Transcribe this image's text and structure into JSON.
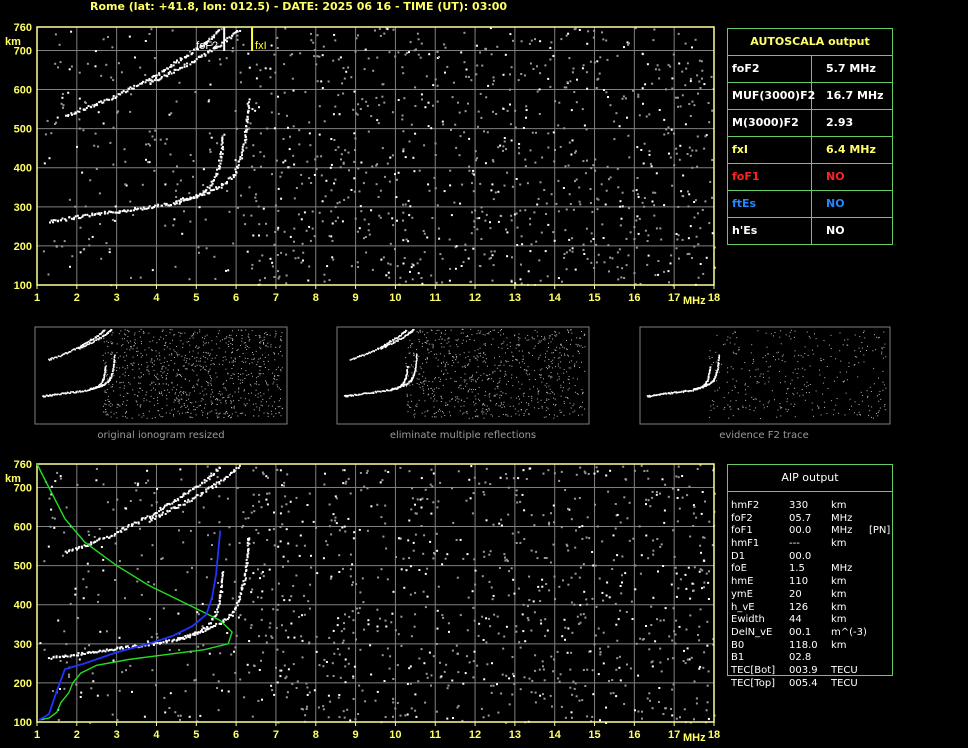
{
  "header": "Rome (lat: +41.8, lon: 012.5) - DATE: 2025 06 16 - TIME (UT): 03:00",
  "colors": {
    "grid": "#7f7f7f",
    "frame": "#ffff99",
    "traceO": "#ffffff",
    "label": "#ffff66",
    "tableBorder": "#66cc66",
    "profile": "#22dd22",
    "fit": "#2233ff",
    "no_red": "#ff2222",
    "no_blue": "#2288ff"
  },
  "chart_data": [
    {
      "type": "scatter",
      "title": "",
      "xlabel": "MHz",
      "ylabel": "km",
      "xlim": [
        1,
        18
      ],
      "ylim": [
        100,
        760
      ],
      "xticks": [
        "1",
        "2",
        "3",
        "4",
        "5",
        "6",
        "7",
        "8",
        "9",
        "10",
        "11",
        "12",
        "13",
        "14",
        "15",
        "16",
        "17",
        "18"
      ],
      "yticks": [
        "100",
        "200",
        "300",
        "400",
        "500",
        "600",
        "700",
        "760"
      ],
      "grid": true,
      "annotations": [
        "foF2",
        "fxI"
      ],
      "foF2_marker_mhz": 5.7,
      "fxI_marker_mhz": 6.4,
      "series": [
        {
          "points_o_lower": [
            [
              1.3,
              265
            ],
            [
              1.6,
              270
            ],
            [
              2,
              276
            ],
            [
              2.5,
              284
            ],
            [
              3,
              290
            ],
            [
              3.5,
              297
            ],
            [
              4,
              304
            ],
            [
              4.5,
              313
            ],
            [
              4.8,
              322
            ],
            [
              5.1,
              335
            ],
            [
              5.3,
              352
            ],
            [
              5.45,
              375
            ],
            [
              5.55,
              405
            ],
            [
              5.62,
              445
            ],
            [
              5.66,
              490
            ]
          ]
        },
        {
          "points_x_lower": [
            [
              4.5,
              316
            ],
            [
              5,
              330
            ],
            [
              5.4,
              345
            ],
            [
              5.7,
              363
            ],
            [
              5.9,
              380
            ],
            [
              6,
              400
            ],
            [
              6.1,
              430
            ],
            [
              6.2,
              470
            ],
            [
              6.25,
              520
            ],
            [
              6.3,
              580
            ]
          ]
        },
        {
          "points_o_upper": [
            [
              1.7,
              535
            ],
            [
              2.2,
              555
            ],
            [
              2.8,
              577
            ],
            [
              3.3,
              603
            ],
            [
              3.8,
              628
            ],
            [
              4.2,
              653
            ],
            [
              4.6,
              680
            ],
            [
              5,
              705
            ],
            [
              5.35,
              732
            ],
            [
              5.6,
              757
            ]
          ]
        },
        {
          "points_x_upper": [
            [
              3.8,
              618
            ],
            [
              4.2,
              638
            ],
            [
              4.7,
              664
            ],
            [
              5.2,
              692
            ],
            [
              5.6,
              718
            ],
            [
              5.9,
              742
            ],
            [
              6.1,
              758
            ]
          ]
        }
      ]
    },
    {
      "type": "line",
      "title": "",
      "xlabel": "MHz",
      "ylabel": "km",
      "xlim": [
        1,
        18
      ],
      "ylim": [
        100,
        760
      ],
      "xticks": [
        "1",
        "2",
        "3",
        "4",
        "5",
        "6",
        "7",
        "8",
        "9",
        "10",
        "11",
        "12",
        "13",
        "14",
        "15",
        "16",
        "17",
        "18"
      ],
      "yticks": [
        "100",
        "200",
        "300",
        "400",
        "500",
        "600",
        "700",
        "760"
      ],
      "grid": true,
      "series": [
        {
          "name": "",
          "points_green": [
            [
              1,
              760
            ],
            [
              1.3,
              700
            ],
            [
              1.7,
              620
            ],
            [
              2.2,
              560
            ],
            [
              3,
              500
            ],
            [
              3.8,
              450
            ],
            [
              4.5,
              415
            ],
            [
              5,
              390
            ],
            [
              5.6,
              360
            ],
            [
              5.9,
              330
            ],
            [
              5.8,
              300
            ],
            [
              5.2,
              285
            ],
            [
              4.2,
              272
            ],
            [
              3.3,
              260
            ],
            [
              2.5,
              245
            ],
            [
              2.1,
              225
            ],
            [
              1.9,
              200
            ],
            [
              1.8,
              175
            ],
            [
              1.6,
              150
            ],
            [
              1.5,
              125
            ],
            [
              1.3,
              110
            ],
            [
              1.05,
              105
            ]
          ]
        },
        {
          "name": "",
          "points_blue": [
            [
              1.05,
              105
            ],
            [
              1.3,
              120
            ],
            [
              1.5,
              180
            ],
            [
              1.7,
              235
            ],
            [
              2.2,
              250
            ],
            [
              3,
              278
            ],
            [
              3.8,
              300
            ],
            [
              4.4,
              320
            ],
            [
              4.9,
              345
            ],
            [
              5.25,
              375
            ],
            [
              5.4,
              420
            ],
            [
              5.5,
              480
            ],
            [
              5.6,
              590
            ]
          ]
        }
      ]
    }
  ],
  "thumbnails": [
    {
      "caption": "original ionogram resized"
    },
    {
      "caption": "eliminate multiple reflections"
    },
    {
      "caption": "evidence F2 trace"
    }
  ],
  "autoscala": {
    "title": "AUTOSCALA output",
    "rows": [
      {
        "key": "foF2",
        "value": "5.7 MHz",
        "kc": "#ffffff",
        "vc": "#ffffff"
      },
      {
        "key": "MUF(3000)F2",
        "value": "16.7 MHz",
        "kc": "#ffffff",
        "vc": "#ffffff"
      },
      {
        "key": "M(3000)F2",
        "value": "2.93",
        "kc": "#ffffff",
        "vc": "#ffffff"
      },
      {
        "key": "fxI",
        "value": "6.4 MHz",
        "kc": "#ffff66",
        "vc": "#ffff66"
      },
      {
        "key": "foF1",
        "value": "NO",
        "kc": "#ff2222",
        "vc": "#ff2222"
      },
      {
        "key": "ftEs",
        "value": "NO",
        "kc": "#2288ff",
        "vc": "#2288ff"
      },
      {
        "key": "h'Es",
        "value": "NO",
        "kc": "#ffffff",
        "vc": "#ffffff"
      }
    ]
  },
  "aip": {
    "title": "AIP output",
    "rows": [
      {
        "n": "hmF2",
        "v": "330",
        "u": "km",
        "x": ""
      },
      {
        "n": "foF2",
        "v": "05.7",
        "u": "MHz",
        "x": ""
      },
      {
        "n": "foF1",
        "v": "00.0",
        "u": "MHz",
        "x": "[PN]"
      },
      {
        "n": "hmF1",
        "v": "---",
        "u": "km",
        "x": ""
      },
      {
        "n": "D1",
        "v": "00.0",
        "u": "",
        "x": ""
      },
      {
        "n": "foE",
        "v": "1.5",
        "u": "MHz",
        "x": ""
      },
      {
        "n": "hmE",
        "v": "110",
        "u": "km",
        "x": ""
      },
      {
        "n": "ymE",
        "v": "20",
        "u": "km",
        "x": ""
      },
      {
        "n": "h_vE",
        "v": "126",
        "u": "km",
        "x": ""
      },
      {
        "n": "Ewidth",
        "v": "44",
        "u": "km",
        "x": ""
      },
      {
        "n": "DelN_vE",
        "v": "00.1",
        "u": "m^(-3)",
        "x": ""
      },
      {
        "n": "B0",
        "v": "118.0",
        "u": "km",
        "x": ""
      },
      {
        "n": "B1",
        "v": "02.8",
        "u": "",
        "x": ""
      },
      {
        "n": "TEC[Bot]",
        "v": "003.9",
        "u": "TECU",
        "x": ""
      },
      {
        "n": "TEC[Top]",
        "v": "005.4",
        "u": "TECU",
        "x": ""
      }
    ]
  }
}
